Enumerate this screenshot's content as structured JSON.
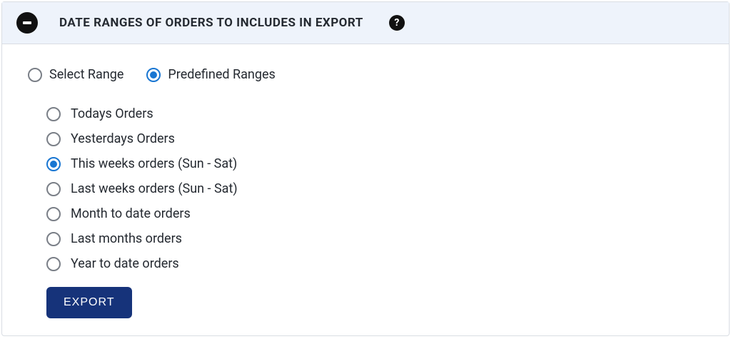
{
  "header": {
    "title": "DATE RANGES OF ORDERS TO INCLUDES IN EXPORT",
    "help_glyph": "?"
  },
  "mode": {
    "select_range": {
      "label": "Select Range",
      "selected": false
    },
    "predefined": {
      "label": "Predefined Ranges",
      "selected": true
    }
  },
  "presets": [
    {
      "label": "Todays Orders",
      "selected": false
    },
    {
      "label": "Yesterdays Orders",
      "selected": false
    },
    {
      "label": "This weeks orders (Sun - Sat)",
      "selected": true
    },
    {
      "label": "Last weeks orders (Sun - Sat)",
      "selected": false
    },
    {
      "label": "Month to date orders",
      "selected": false
    },
    {
      "label": "Last months orders",
      "selected": false
    },
    {
      "label": "Year to date orders",
      "selected": false
    }
  ],
  "buttons": {
    "export": "EXPORT"
  }
}
